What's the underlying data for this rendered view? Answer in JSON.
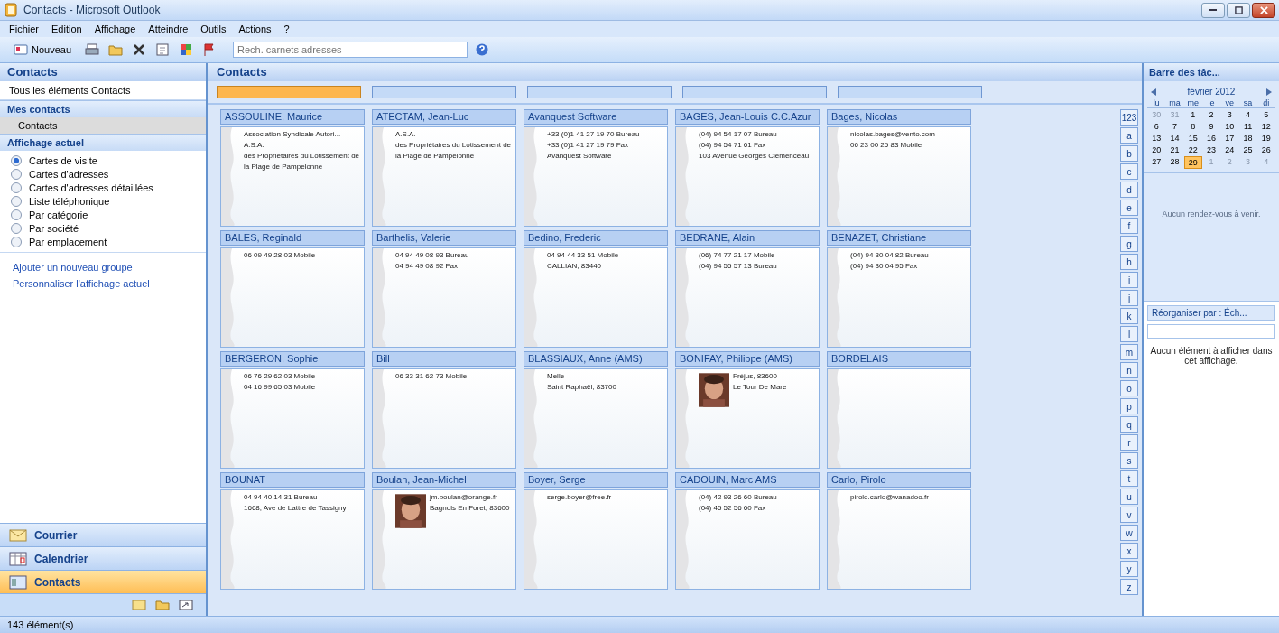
{
  "window": {
    "title": "Contacts - Microsoft Outlook"
  },
  "menu": [
    "Fichier",
    "Edition",
    "Affichage",
    "Atteindre",
    "Outils",
    "Actions",
    "?"
  ],
  "toolbar": {
    "new_label": "Nouveau",
    "search": {
      "placeholder": "Rech. carnets adresses"
    }
  },
  "nav": {
    "title": "Contacts",
    "all_items": "Tous les éléments Contacts",
    "my_contacts": {
      "title": "Mes contacts",
      "items": [
        {
          "label": "Contacts",
          "selected": true
        }
      ]
    },
    "views": {
      "title": "Affichage actuel",
      "items": [
        {
          "label": "Cartes de visite",
          "selected": true
        },
        {
          "label": "Cartes d'adresses",
          "selected": false
        },
        {
          "label": "Cartes d'adresses détaillées",
          "selected": false
        },
        {
          "label": "Liste téléphonique",
          "selected": false
        },
        {
          "label": "Par catégorie",
          "selected": false
        },
        {
          "label": "Par société",
          "selected": false
        },
        {
          "label": "Par emplacement",
          "selected": false
        }
      ]
    },
    "links": [
      "Ajouter un nouveau groupe",
      "Personnaliser l'affichage actuel"
    ],
    "buttons": [
      {
        "label": "Courrier",
        "kind": "mail",
        "selected": false
      },
      {
        "label": "Calendrier",
        "kind": "calendar",
        "selected": false
      },
      {
        "label": "Contacts",
        "kind": "contacts",
        "selected": true
      }
    ]
  },
  "main": {
    "title": "Contacts",
    "range_tabs": [
      {
        "selected": true
      },
      {
        "selected": false
      },
      {
        "selected": false
      },
      {
        "selected": false
      },
      {
        "selected": false
      }
    ],
    "cards": [
      {
        "name": "ASSOULINE, Maurice",
        "photo": false,
        "lines": [
          "Association Syndicale Autori...",
          "A.S.A.",
          "des Propriétaires du Lotissement de",
          "la Plage de Pampelonne"
        ]
      },
      {
        "name": "ATECTAM, Jean-Luc",
        "photo": false,
        "lines": [
          "A.S.A.",
          "des Propriétaires du Lotissement de",
          "la Plage de Pampelonne"
        ]
      },
      {
        "name": "Avanquest Software",
        "photo": false,
        "lines": [
          "+33 (0)1 41 27 19 70 Bureau",
          "+33 (0)1 41 27 19 79 Fax",
          "Avanquest Software"
        ]
      },
      {
        "name": "BAGES, Jean-Louis C.C.Azur",
        "photo": false,
        "lines": [
          "(04) 94 54 17 07 Bureau",
          "(04) 94 54 71 61 Fax",
          "103 Avenue Georges Clemenceau"
        ]
      },
      {
        "name": "Bages, Nicolas",
        "photo": false,
        "lines": [
          "nicolas.bages@vento.com",
          "06 23 00 25 83 Mobile"
        ]
      },
      {
        "name": "BALES, Reginald",
        "photo": false,
        "lines": [
          "06 09 49 28 03 Mobile"
        ]
      },
      {
        "name": "Barthelis, Valerie",
        "photo": false,
        "lines": [
          "04 94 49 08 93 Bureau",
          "04 94 49 08 92 Fax"
        ]
      },
      {
        "name": "Bedino, Frederic",
        "photo": false,
        "lines": [
          "04 94 44 33 51 Mobile",
          "CALLIAN, 83440"
        ]
      },
      {
        "name": "BEDRANE, Alain",
        "photo": false,
        "lines": [
          "(06) 74 77 21 17 Mobile",
          "(04) 94 55 57 13 Bureau"
        ]
      },
      {
        "name": "BENAZET, Christiane",
        "photo": false,
        "lines": [
          "(04) 94 30 04 82 Bureau",
          "(04) 94 30 04 95 Fax"
        ]
      },
      {
        "name": "BERGERON, Sophie",
        "photo": false,
        "lines": [
          "06 76 29 62 03 Mobile",
          "04 16 99 65 03 Mobile"
        ]
      },
      {
        "name": "Bill",
        "photo": false,
        "lines": [
          "06 33 31 62 73 Mobile"
        ]
      },
      {
        "name": "BLASSIAUX, Anne (AMS)",
        "photo": false,
        "lines": [
          "Melle",
          "Saint Raphaël, 83700"
        ]
      },
      {
        "name": "BONIFAY, Philippe (AMS)",
        "photo": true,
        "lines": [
          "Fréjus, 83600",
          "Le Tour De Mare"
        ]
      },
      {
        "name": "BORDELAIS",
        "photo": false
      },
      {
        "name": "BOUNAT",
        "photo": false,
        "lines": [
          "04 94 40 14 31 Bureau",
          "1668, Ave de Lattre de Tassigny"
        ]
      },
      {
        "name": "Boulan, Jean-Michel",
        "photo": true,
        "lines": [
          "jm.boulan@orange.fr",
          "Bagnols En Foret, 83600"
        ]
      },
      {
        "name": "Boyer, Serge",
        "photo": false,
        "lines": [
          "serge.boyer@free.fr"
        ]
      },
      {
        "name": "CADOUIN, Marc AMS",
        "photo": false,
        "lines": [
          "(04) 42 93 26 60 Bureau",
          "(04) 45 52 56 60 Fax"
        ]
      },
      {
        "name": "Carlo, Pirolo",
        "photo": false,
        "lines": [
          "pirolo.carlo@wanadoo.fr"
        ]
      }
    ],
    "index": [
      "123",
      "a",
      "b",
      "c",
      "d",
      "e",
      "f",
      "g",
      "h",
      "i",
      "j",
      "k",
      "l",
      "m",
      "n",
      "o",
      "p",
      "q",
      "r",
      "s",
      "t",
      "u",
      "v",
      "w",
      "x",
      "y",
      "z"
    ]
  },
  "todo": {
    "title": "Barre des tâc...",
    "month": "février 2012",
    "weekdays": [
      "lu",
      "ma",
      "me",
      "je",
      "ve",
      "sa",
      "di"
    ],
    "days": [
      {
        "d": "30",
        "muted": true,
        "selected": false
      },
      {
        "d": "31",
        "muted": true,
        "selected": false
      },
      {
        "d": "1",
        "muted": false,
        "selected": false
      },
      {
        "d": "2",
        "muted": false,
        "selected": false
      },
      {
        "d": "3",
        "muted": false,
        "selected": false
      },
      {
        "d": "4",
        "muted": false,
        "selected": false
      },
      {
        "d": "5",
        "muted": false,
        "selected": false
      },
      {
        "d": "6",
        "muted": false,
        "selected": false
      },
      {
        "d": "7",
        "muted": false,
        "selected": false
      },
      {
        "d": "8",
        "muted": false,
        "selected": false
      },
      {
        "d": "9",
        "muted": false,
        "selected": false
      },
      {
        "d": "10",
        "muted": false,
        "selected": false
      },
      {
        "d": "11",
        "muted": false,
        "selected": false
      },
      {
        "d": "12",
        "muted": false,
        "selected": false
      },
      {
        "d": "13",
        "muted": false,
        "selected": false
      },
      {
        "d": "14",
        "muted": false,
        "selected": false
      },
      {
        "d": "15",
        "muted": false,
        "selected": false
      },
      {
        "d": "16",
        "muted": false,
        "selected": false
      },
      {
        "d": "17",
        "muted": false,
        "selected": false
      },
      {
        "d": "18",
        "muted": false,
        "selected": false
      },
      {
        "d": "19",
        "muted": false,
        "selected": false
      },
      {
        "d": "20",
        "muted": false,
        "selected": false
      },
      {
        "d": "21",
        "muted": false,
        "selected": false
      },
      {
        "d": "22",
        "muted": false,
        "selected": false
      },
      {
        "d": "23",
        "muted": false,
        "selected": false
      },
      {
        "d": "24",
        "muted": false,
        "selected": false
      },
      {
        "d": "25",
        "muted": false,
        "selected": false
      },
      {
        "d": "26",
        "muted": false,
        "selected": false
      },
      {
        "d": "27",
        "muted": false,
        "selected": false
      },
      {
        "d": "28",
        "muted": false,
        "selected": false
      },
      {
        "d": "29",
        "muted": false,
        "selected": true
      },
      {
        "d": "1",
        "muted": true,
        "selected": false
      },
      {
        "d": "2",
        "muted": true,
        "selected": false
      },
      {
        "d": "3",
        "muted": true,
        "selected": false
      },
      {
        "d": "4",
        "muted": true,
        "selected": false
      }
    ],
    "appointments": "Aucun rendez-vous à venir.",
    "arrange": "Réorganiser par : Éch...",
    "empty": "Aucun élément à afficher dans cet affichage."
  },
  "status_bar": "143 élément(s)"
}
